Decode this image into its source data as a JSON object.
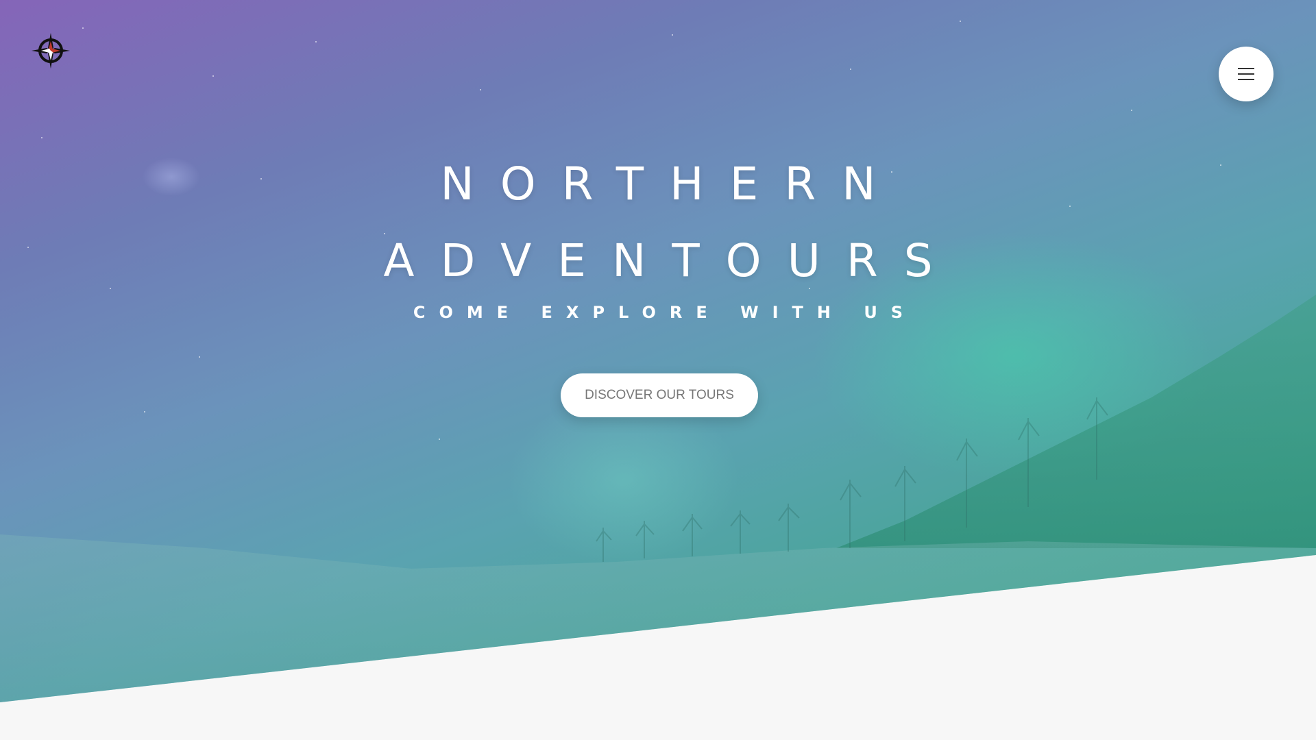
{
  "header": {
    "logo_icon": "compass-rose-icon",
    "menu_icon": "hamburger-menu-icon"
  },
  "hero": {
    "title_line_1": "NORTHERN",
    "title_line_2": "ADVENTOURS",
    "subtitle": "COME EXPLORE WITH US",
    "cta_label": "DISCOVER OUR TOURS"
  },
  "colors": {
    "gradient_top_left": "#8565b8",
    "gradient_bottom_right": "#2f9c84",
    "page_background": "#f7f7f7",
    "button_background": "#ffffff",
    "button_text": "#777777"
  }
}
